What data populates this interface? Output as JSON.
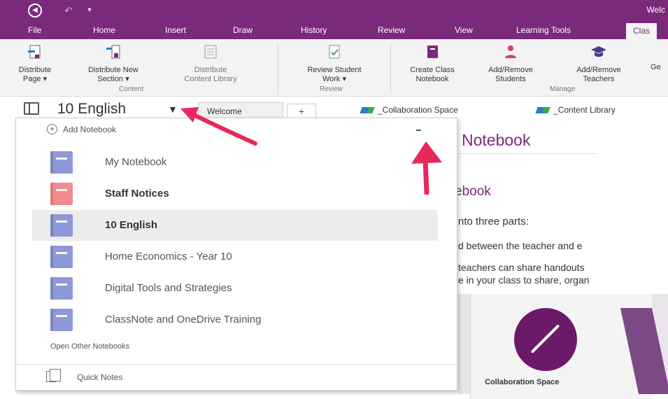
{
  "titlebar": {
    "title": "Welc"
  },
  "tabs": [
    {
      "label": "File"
    },
    {
      "label": "Home"
    },
    {
      "label": "Insert"
    },
    {
      "label": "Draw"
    },
    {
      "label": "History"
    },
    {
      "label": "Review"
    },
    {
      "label": "View"
    },
    {
      "label": "Learning Tools"
    },
    {
      "label": "Clas"
    }
  ],
  "ribbon": {
    "buttons": [
      {
        "label": "Distribute\nPage ▾"
      },
      {
        "label": "Distribute New\nSection ▾"
      },
      {
        "label": "Distribute\nContent Library"
      },
      {
        "label": "Review Student\nWork ▾"
      },
      {
        "label": "Create Class\nNotebook"
      },
      {
        "label": "Add/Remove\nStudents"
      },
      {
        "label": "Add/Remove\nTeachers"
      },
      {
        "label": "Ge"
      }
    ],
    "groups": [
      {
        "label": "Content"
      },
      {
        "label": "Review"
      },
      {
        "label": "Manage"
      }
    ]
  },
  "nav": {
    "notebook_title": "10 English",
    "section_tab": "Welcome",
    "add_tab": "+",
    "section_groups": [
      "_Collaboration Space",
      "_Content Library"
    ]
  },
  "dropdown": {
    "add_notebook": "Add Notebook",
    "notebooks": [
      {
        "label": "My Notebook",
        "color": "#8d98d8"
      },
      {
        "label": "Staff Notices",
        "color": "#f28b8b"
      },
      {
        "label": "10 English",
        "color": "#8d98d8"
      },
      {
        "label": "Home Economics - Year 10",
        "color": "#8d98d8"
      },
      {
        "label": "Digital Tools and Strategies",
        "color": "#8d98d8"
      },
      {
        "label": "ClassNote and OneDrive Training",
        "color": "#8d98d8"
      }
    ],
    "open_other": "Open Other Notebooks",
    "quick_notes": "Quick Notes"
  },
  "page": {
    "heading": "Notebook",
    "subheading": "ebook",
    "lines": [
      "nto three parts:",
      "d between the teacher and e",
      "teachers can share handouts",
      "e in your class to share, organ"
    ],
    "caption": "Collaboration Space"
  },
  "colors": {
    "accent": "#7a2a7b",
    "arrow": "#e8285a"
  }
}
